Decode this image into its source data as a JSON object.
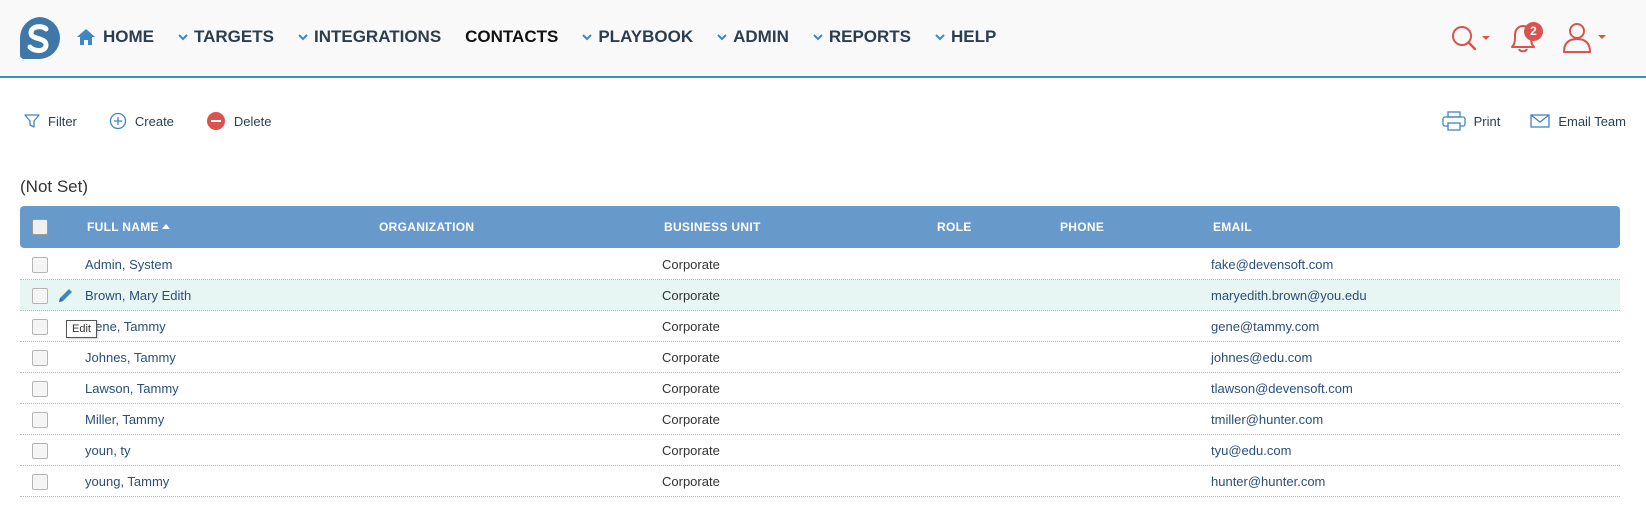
{
  "nav": {
    "items": [
      {
        "label": "HOME",
        "type": "home"
      },
      {
        "label": "TARGETS",
        "type": "dropdown"
      },
      {
        "label": "INTEGRATIONS",
        "type": "dropdown"
      },
      {
        "label": "CONTACTS",
        "type": "active"
      },
      {
        "label": "PLAYBOOK",
        "type": "dropdown"
      },
      {
        "label": "ADMIN",
        "type": "dropdown"
      },
      {
        "label": "REPORTS",
        "type": "dropdown"
      },
      {
        "label": "HELP",
        "type": "dropdown"
      }
    ],
    "notification_count": "2",
    "icons": {
      "search": "search-icon",
      "bell": "bell-icon",
      "user": "user-icon"
    },
    "accent_color": "#d9534f"
  },
  "toolbar": {
    "filter_label": "Filter",
    "create_label": "Create",
    "delete_label": "Delete",
    "print_label": "Print",
    "email_team_label": "Email Team"
  },
  "group": {
    "title": "(Not Set)"
  },
  "table": {
    "header_color": "#6899cb",
    "columns": {
      "full_name": "FULL NAME",
      "organization": "ORGANIZATION",
      "business_unit": "BUSINESS UNIT",
      "role": "ROLE",
      "phone": "PHONE",
      "email": "EMAIL"
    },
    "sort": {
      "column": "full_name",
      "direction": "ascending"
    },
    "rows": [
      {
        "name": "Admin, System",
        "organization": "",
        "business_unit": "Corporate",
        "role": "",
        "phone": "",
        "email": "fake@devensoft.com"
      },
      {
        "name": "Brown, Mary Edith",
        "organization": "",
        "business_unit": "Corporate",
        "role": "",
        "phone": "",
        "email": "maryedith.brown@you.edu"
      },
      {
        "name": "Gene, Tammy",
        "organization": "",
        "business_unit": "Corporate",
        "role": "",
        "phone": "",
        "email": "gene@tammy.com"
      },
      {
        "name": "Johnes, Tammy",
        "organization": "",
        "business_unit": "Corporate",
        "role": "",
        "phone": "",
        "email": "johnes@edu.com"
      },
      {
        "name": "Lawson, Tammy",
        "organization": "",
        "business_unit": "Corporate",
        "role": "",
        "phone": "",
        "email": "tlawson@devensoft.com"
      },
      {
        "name": "Miller, Tammy",
        "organization": "",
        "business_unit": "Corporate",
        "role": "",
        "phone": "",
        "email": "tmiller@hunter.com"
      },
      {
        "name": "youn, ty",
        "organization": "",
        "business_unit": "Corporate",
        "role": "",
        "phone": "",
        "email": "tyu@edu.com"
      },
      {
        "name": "young, Tammy",
        "organization": "",
        "business_unit": "Corporate",
        "role": "",
        "phone": "",
        "email": "hunter@hunter.com"
      }
    ]
  },
  "tooltip": {
    "text": "Edit"
  }
}
